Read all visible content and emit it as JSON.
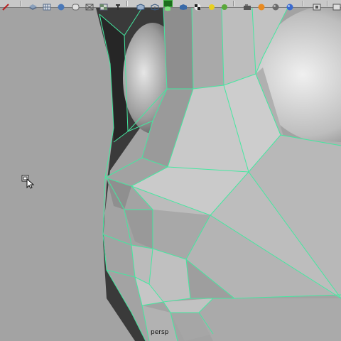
{
  "toolbar": {
    "buttons": [
      {
        "name": "paint-brush-icon",
        "color": "#b82020"
      },
      {
        "name": "layers-icon",
        "color": "#5a6e8c"
      },
      {
        "name": "grid-icon",
        "color": "#7a8aa4"
      },
      {
        "name": "sphere-icon",
        "color": "#4a78b8"
      },
      {
        "name": "cylinder-icon",
        "color": "#9aa0a8"
      },
      {
        "name": "wireframe-icon",
        "color": "#8a8a8a"
      },
      {
        "name": "checker-icon",
        "color": "#6a8a6a"
      },
      {
        "name": "smooth-shade-icon",
        "color": "#4c4c4c"
      },
      {
        "name": "cube-icon",
        "color": "#5a7aa0"
      },
      {
        "name": "cube-wire-icon",
        "color": "#7a9aba"
      },
      {
        "name": "isolate-select-icon",
        "color": "#3fae3f"
      },
      {
        "name": "cube-blue-icon",
        "color": "#3a6aa8"
      },
      {
        "name": "texture-checker-icon",
        "color": "#222222"
      },
      {
        "name": "light-yellow-icon",
        "color": "#e8d020"
      },
      {
        "name": "light-green-icon",
        "color": "#5aa83a"
      },
      {
        "name": "camera-icon",
        "color": "#7a7a7a"
      },
      {
        "name": "orange-light-icon",
        "color": "#e88a20"
      },
      {
        "name": "shaded-sphere-icon",
        "color": "#6a6a6a"
      },
      {
        "name": "blue-sphere-icon",
        "color": "#3a6ad0"
      },
      {
        "name": "resolution-gate-icon",
        "color": "#8a8a8a"
      }
    ]
  },
  "viewport": {
    "camera_label": "persp",
    "background_color": "#a3a3a3",
    "wire_color": "#44e8a0"
  }
}
